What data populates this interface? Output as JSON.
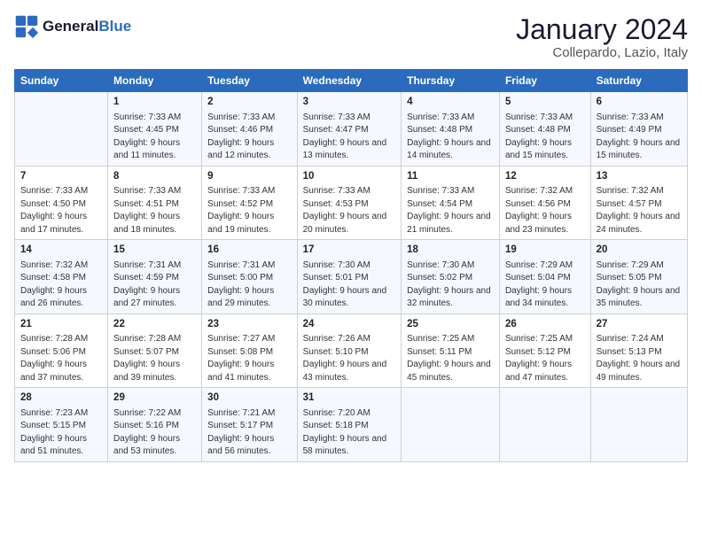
{
  "header": {
    "logo_general": "General",
    "logo_blue": "Blue",
    "title": "January 2024",
    "subtitle": "Collepardo, Lazio, Italy"
  },
  "columns": [
    "Sunday",
    "Monday",
    "Tuesday",
    "Wednesday",
    "Thursday",
    "Friday",
    "Saturday"
  ],
  "weeks": [
    [
      {
        "day": "",
        "sunrise": "",
        "sunset": "",
        "daylight": ""
      },
      {
        "day": "1",
        "sunrise": "Sunrise: 7:33 AM",
        "sunset": "Sunset: 4:45 PM",
        "daylight": "Daylight: 9 hours and 11 minutes."
      },
      {
        "day": "2",
        "sunrise": "Sunrise: 7:33 AM",
        "sunset": "Sunset: 4:46 PM",
        "daylight": "Daylight: 9 hours and 12 minutes."
      },
      {
        "day": "3",
        "sunrise": "Sunrise: 7:33 AM",
        "sunset": "Sunset: 4:47 PM",
        "daylight": "Daylight: 9 hours and 13 minutes."
      },
      {
        "day": "4",
        "sunrise": "Sunrise: 7:33 AM",
        "sunset": "Sunset: 4:48 PM",
        "daylight": "Daylight: 9 hours and 14 minutes."
      },
      {
        "day": "5",
        "sunrise": "Sunrise: 7:33 AM",
        "sunset": "Sunset: 4:48 PM",
        "daylight": "Daylight: 9 hours and 15 minutes."
      },
      {
        "day": "6",
        "sunrise": "Sunrise: 7:33 AM",
        "sunset": "Sunset: 4:49 PM",
        "daylight": "Daylight: 9 hours and 15 minutes."
      }
    ],
    [
      {
        "day": "7",
        "sunrise": "Sunrise: 7:33 AM",
        "sunset": "Sunset: 4:50 PM",
        "daylight": "Daylight: 9 hours and 17 minutes."
      },
      {
        "day": "8",
        "sunrise": "Sunrise: 7:33 AM",
        "sunset": "Sunset: 4:51 PM",
        "daylight": "Daylight: 9 hours and 18 minutes."
      },
      {
        "day": "9",
        "sunrise": "Sunrise: 7:33 AM",
        "sunset": "Sunset: 4:52 PM",
        "daylight": "Daylight: 9 hours and 19 minutes."
      },
      {
        "day": "10",
        "sunrise": "Sunrise: 7:33 AM",
        "sunset": "Sunset: 4:53 PM",
        "daylight": "Daylight: 9 hours and 20 minutes."
      },
      {
        "day": "11",
        "sunrise": "Sunrise: 7:33 AM",
        "sunset": "Sunset: 4:54 PM",
        "daylight": "Daylight: 9 hours and 21 minutes."
      },
      {
        "day": "12",
        "sunrise": "Sunrise: 7:32 AM",
        "sunset": "Sunset: 4:56 PM",
        "daylight": "Daylight: 9 hours and 23 minutes."
      },
      {
        "day": "13",
        "sunrise": "Sunrise: 7:32 AM",
        "sunset": "Sunset: 4:57 PM",
        "daylight": "Daylight: 9 hours and 24 minutes."
      }
    ],
    [
      {
        "day": "14",
        "sunrise": "Sunrise: 7:32 AM",
        "sunset": "Sunset: 4:58 PM",
        "daylight": "Daylight: 9 hours and 26 minutes."
      },
      {
        "day": "15",
        "sunrise": "Sunrise: 7:31 AM",
        "sunset": "Sunset: 4:59 PM",
        "daylight": "Daylight: 9 hours and 27 minutes."
      },
      {
        "day": "16",
        "sunrise": "Sunrise: 7:31 AM",
        "sunset": "Sunset: 5:00 PM",
        "daylight": "Daylight: 9 hours and 29 minutes."
      },
      {
        "day": "17",
        "sunrise": "Sunrise: 7:30 AM",
        "sunset": "Sunset: 5:01 PM",
        "daylight": "Daylight: 9 hours and 30 minutes."
      },
      {
        "day": "18",
        "sunrise": "Sunrise: 7:30 AM",
        "sunset": "Sunset: 5:02 PM",
        "daylight": "Daylight: 9 hours and 32 minutes."
      },
      {
        "day": "19",
        "sunrise": "Sunrise: 7:29 AM",
        "sunset": "Sunset: 5:04 PM",
        "daylight": "Daylight: 9 hours and 34 minutes."
      },
      {
        "day": "20",
        "sunrise": "Sunrise: 7:29 AM",
        "sunset": "Sunset: 5:05 PM",
        "daylight": "Daylight: 9 hours and 35 minutes."
      }
    ],
    [
      {
        "day": "21",
        "sunrise": "Sunrise: 7:28 AM",
        "sunset": "Sunset: 5:06 PM",
        "daylight": "Daylight: 9 hours and 37 minutes."
      },
      {
        "day": "22",
        "sunrise": "Sunrise: 7:28 AM",
        "sunset": "Sunset: 5:07 PM",
        "daylight": "Daylight: 9 hours and 39 minutes."
      },
      {
        "day": "23",
        "sunrise": "Sunrise: 7:27 AM",
        "sunset": "Sunset: 5:08 PM",
        "daylight": "Daylight: 9 hours and 41 minutes."
      },
      {
        "day": "24",
        "sunrise": "Sunrise: 7:26 AM",
        "sunset": "Sunset: 5:10 PM",
        "daylight": "Daylight: 9 hours and 43 minutes."
      },
      {
        "day": "25",
        "sunrise": "Sunrise: 7:25 AM",
        "sunset": "Sunset: 5:11 PM",
        "daylight": "Daylight: 9 hours and 45 minutes."
      },
      {
        "day": "26",
        "sunrise": "Sunrise: 7:25 AM",
        "sunset": "Sunset: 5:12 PM",
        "daylight": "Daylight: 9 hours and 47 minutes."
      },
      {
        "day": "27",
        "sunrise": "Sunrise: 7:24 AM",
        "sunset": "Sunset: 5:13 PM",
        "daylight": "Daylight: 9 hours and 49 minutes."
      }
    ],
    [
      {
        "day": "28",
        "sunrise": "Sunrise: 7:23 AM",
        "sunset": "Sunset: 5:15 PM",
        "daylight": "Daylight: 9 hours and 51 minutes."
      },
      {
        "day": "29",
        "sunrise": "Sunrise: 7:22 AM",
        "sunset": "Sunset: 5:16 PM",
        "daylight": "Daylight: 9 hours and 53 minutes."
      },
      {
        "day": "30",
        "sunrise": "Sunrise: 7:21 AM",
        "sunset": "Sunset: 5:17 PM",
        "daylight": "Daylight: 9 hours and 56 minutes."
      },
      {
        "day": "31",
        "sunrise": "Sunrise: 7:20 AM",
        "sunset": "Sunset: 5:18 PM",
        "daylight": "Daylight: 9 hours and 58 minutes."
      },
      {
        "day": "",
        "sunrise": "",
        "sunset": "",
        "daylight": ""
      },
      {
        "day": "",
        "sunrise": "",
        "sunset": "",
        "daylight": ""
      },
      {
        "day": "",
        "sunrise": "",
        "sunset": "",
        "daylight": ""
      }
    ]
  ]
}
